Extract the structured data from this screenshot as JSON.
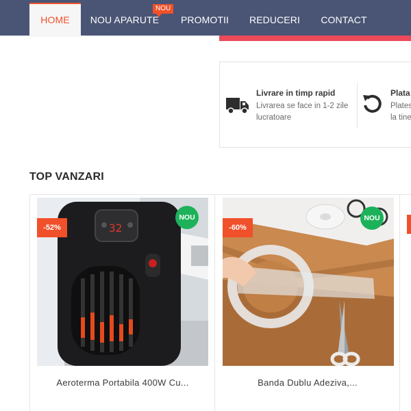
{
  "nav": {
    "items": [
      {
        "label": "HOME",
        "active": true
      },
      {
        "label": "NOU APARUTE",
        "badge": "NOU"
      },
      {
        "label": "PROMOTII"
      },
      {
        "label": "REDUCERI"
      },
      {
        "label": "CONTACT"
      }
    ]
  },
  "features": [
    {
      "icon": "truck-icon",
      "title": "Livrare in timp rapid",
      "desc_line1": "Livrarea se face in 1-2 zile",
      "desc_line2": "lucratoare"
    },
    {
      "icon": "return-arrow-icon",
      "title": "Plata",
      "desc_line1": "Plates",
      "desc_line2": "la tine"
    }
  ],
  "section": {
    "title": "TOP VANZARI"
  },
  "products": [
    {
      "name": "Aeroterma Portabila 400W Cu...",
      "discount": "-52%",
      "badge": "NOU",
      "image": "portable-heater-image"
    },
    {
      "name": "Banda Dublu Adeziva,...",
      "discount": "-60%",
      "badge": "NOU",
      "image": "double-sided-tape-image"
    }
  ],
  "colors": {
    "nav_bg": "#4a5575",
    "accent": "#f0502a",
    "new_badge": "#1db25a",
    "strip": "#ec4a5a"
  }
}
